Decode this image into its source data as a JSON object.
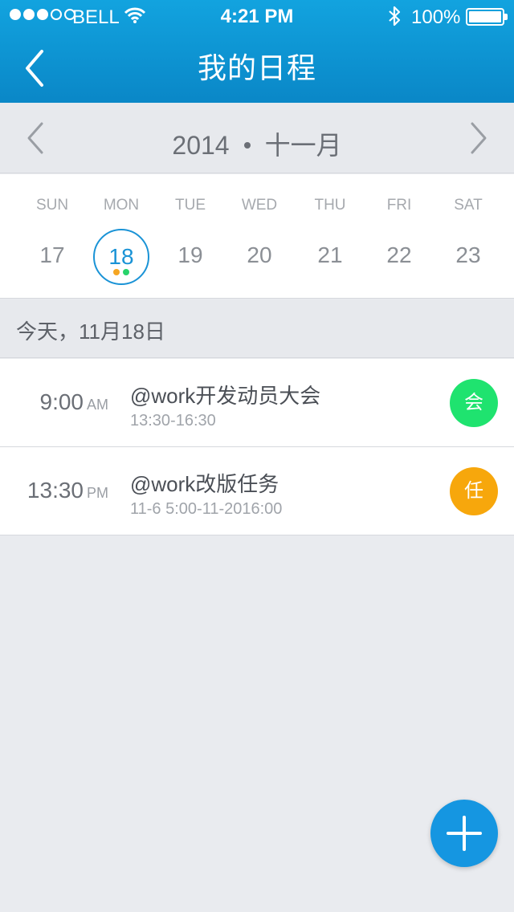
{
  "status_bar": {
    "carrier": "BELL",
    "time": "4:21 PM",
    "battery": "100%",
    "signal_bars_filled": 3,
    "signal_bars_total": 5
  },
  "nav": {
    "title": "我的日程",
    "back_icon": "chevron-left-icon"
  },
  "month_bar": {
    "year": "2014",
    "month": "十一月",
    "prev_icon": "chevron-left-icon",
    "next_icon": "chevron-right-icon"
  },
  "week": {
    "days": [
      {
        "dow": "SUN",
        "day": "17"
      },
      {
        "dow": "MON",
        "day": "18",
        "selected": true,
        "dots": [
          "#f5a623",
          "#27d36b"
        ]
      },
      {
        "dow": "TUE",
        "day": "19"
      },
      {
        "dow": "WED",
        "day": "20"
      },
      {
        "dow": "THU",
        "day": "21"
      },
      {
        "dow": "FRI",
        "day": "22"
      },
      {
        "dow": "SAT",
        "day": "23"
      }
    ]
  },
  "date_header": "今天，11月18日",
  "events": [
    {
      "time": "9:00",
      "ampm": "AM",
      "title": "@work开发动员大会",
      "range": "13:30-16:30",
      "badge": "会",
      "badge_color": "#1fe36f"
    },
    {
      "time": "13:30",
      "ampm": "PM",
      "title": "@work改版任务",
      "range": "11-6 5:00-11-2016:00",
      "badge": "任",
      "badge_color": "#f7a70c"
    }
  ],
  "fab_icon": "plus-icon",
  "colors": {
    "accent": "#1596e1",
    "header": "#0a87c7"
  }
}
